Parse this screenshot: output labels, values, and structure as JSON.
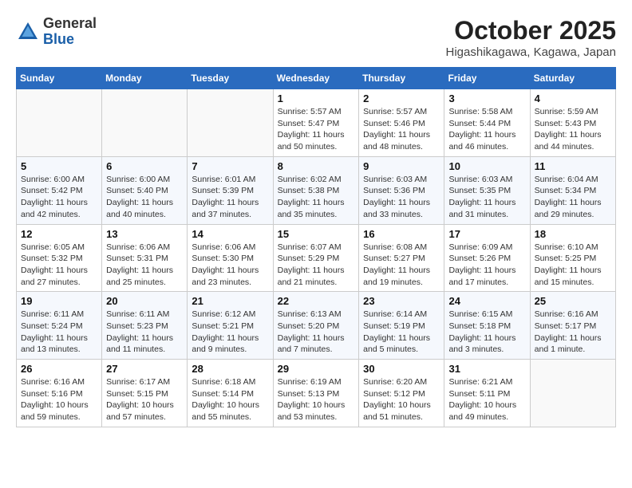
{
  "header": {
    "logo_general": "General",
    "logo_blue": "Blue",
    "month_title": "October 2025",
    "location": "Higashikagawa, Kagawa, Japan"
  },
  "weekdays": [
    "Sunday",
    "Monday",
    "Tuesday",
    "Wednesday",
    "Thursday",
    "Friday",
    "Saturday"
  ],
  "weeks": [
    [
      {
        "day": "",
        "info": ""
      },
      {
        "day": "",
        "info": ""
      },
      {
        "day": "",
        "info": ""
      },
      {
        "day": "1",
        "info": "Sunrise: 5:57 AM\nSunset: 5:47 PM\nDaylight: 11 hours\nand 50 minutes."
      },
      {
        "day": "2",
        "info": "Sunrise: 5:57 AM\nSunset: 5:46 PM\nDaylight: 11 hours\nand 48 minutes."
      },
      {
        "day": "3",
        "info": "Sunrise: 5:58 AM\nSunset: 5:44 PM\nDaylight: 11 hours\nand 46 minutes."
      },
      {
        "day": "4",
        "info": "Sunrise: 5:59 AM\nSunset: 5:43 PM\nDaylight: 11 hours\nand 44 minutes."
      }
    ],
    [
      {
        "day": "5",
        "info": "Sunrise: 6:00 AM\nSunset: 5:42 PM\nDaylight: 11 hours\nand 42 minutes."
      },
      {
        "day": "6",
        "info": "Sunrise: 6:00 AM\nSunset: 5:40 PM\nDaylight: 11 hours\nand 40 minutes."
      },
      {
        "day": "7",
        "info": "Sunrise: 6:01 AM\nSunset: 5:39 PM\nDaylight: 11 hours\nand 37 minutes."
      },
      {
        "day": "8",
        "info": "Sunrise: 6:02 AM\nSunset: 5:38 PM\nDaylight: 11 hours\nand 35 minutes."
      },
      {
        "day": "9",
        "info": "Sunrise: 6:03 AM\nSunset: 5:36 PM\nDaylight: 11 hours\nand 33 minutes."
      },
      {
        "day": "10",
        "info": "Sunrise: 6:03 AM\nSunset: 5:35 PM\nDaylight: 11 hours\nand 31 minutes."
      },
      {
        "day": "11",
        "info": "Sunrise: 6:04 AM\nSunset: 5:34 PM\nDaylight: 11 hours\nand 29 minutes."
      }
    ],
    [
      {
        "day": "12",
        "info": "Sunrise: 6:05 AM\nSunset: 5:32 PM\nDaylight: 11 hours\nand 27 minutes."
      },
      {
        "day": "13",
        "info": "Sunrise: 6:06 AM\nSunset: 5:31 PM\nDaylight: 11 hours\nand 25 minutes."
      },
      {
        "day": "14",
        "info": "Sunrise: 6:06 AM\nSunset: 5:30 PM\nDaylight: 11 hours\nand 23 minutes."
      },
      {
        "day": "15",
        "info": "Sunrise: 6:07 AM\nSunset: 5:29 PM\nDaylight: 11 hours\nand 21 minutes."
      },
      {
        "day": "16",
        "info": "Sunrise: 6:08 AM\nSunset: 5:27 PM\nDaylight: 11 hours\nand 19 minutes."
      },
      {
        "day": "17",
        "info": "Sunrise: 6:09 AM\nSunset: 5:26 PM\nDaylight: 11 hours\nand 17 minutes."
      },
      {
        "day": "18",
        "info": "Sunrise: 6:10 AM\nSunset: 5:25 PM\nDaylight: 11 hours\nand 15 minutes."
      }
    ],
    [
      {
        "day": "19",
        "info": "Sunrise: 6:11 AM\nSunset: 5:24 PM\nDaylight: 11 hours\nand 13 minutes."
      },
      {
        "day": "20",
        "info": "Sunrise: 6:11 AM\nSunset: 5:23 PM\nDaylight: 11 hours\nand 11 minutes."
      },
      {
        "day": "21",
        "info": "Sunrise: 6:12 AM\nSunset: 5:21 PM\nDaylight: 11 hours\nand 9 minutes."
      },
      {
        "day": "22",
        "info": "Sunrise: 6:13 AM\nSunset: 5:20 PM\nDaylight: 11 hours\nand 7 minutes."
      },
      {
        "day": "23",
        "info": "Sunrise: 6:14 AM\nSunset: 5:19 PM\nDaylight: 11 hours\nand 5 minutes."
      },
      {
        "day": "24",
        "info": "Sunrise: 6:15 AM\nSunset: 5:18 PM\nDaylight: 11 hours\nand 3 minutes."
      },
      {
        "day": "25",
        "info": "Sunrise: 6:16 AM\nSunset: 5:17 PM\nDaylight: 11 hours\nand 1 minute."
      }
    ],
    [
      {
        "day": "26",
        "info": "Sunrise: 6:16 AM\nSunset: 5:16 PM\nDaylight: 10 hours\nand 59 minutes."
      },
      {
        "day": "27",
        "info": "Sunrise: 6:17 AM\nSunset: 5:15 PM\nDaylight: 10 hours\nand 57 minutes."
      },
      {
        "day": "28",
        "info": "Sunrise: 6:18 AM\nSunset: 5:14 PM\nDaylight: 10 hours\nand 55 minutes."
      },
      {
        "day": "29",
        "info": "Sunrise: 6:19 AM\nSunset: 5:13 PM\nDaylight: 10 hours\nand 53 minutes."
      },
      {
        "day": "30",
        "info": "Sunrise: 6:20 AM\nSunset: 5:12 PM\nDaylight: 10 hours\nand 51 minutes."
      },
      {
        "day": "31",
        "info": "Sunrise: 6:21 AM\nSunset: 5:11 PM\nDaylight: 10 hours\nand 49 minutes."
      },
      {
        "day": "",
        "info": ""
      }
    ]
  ]
}
